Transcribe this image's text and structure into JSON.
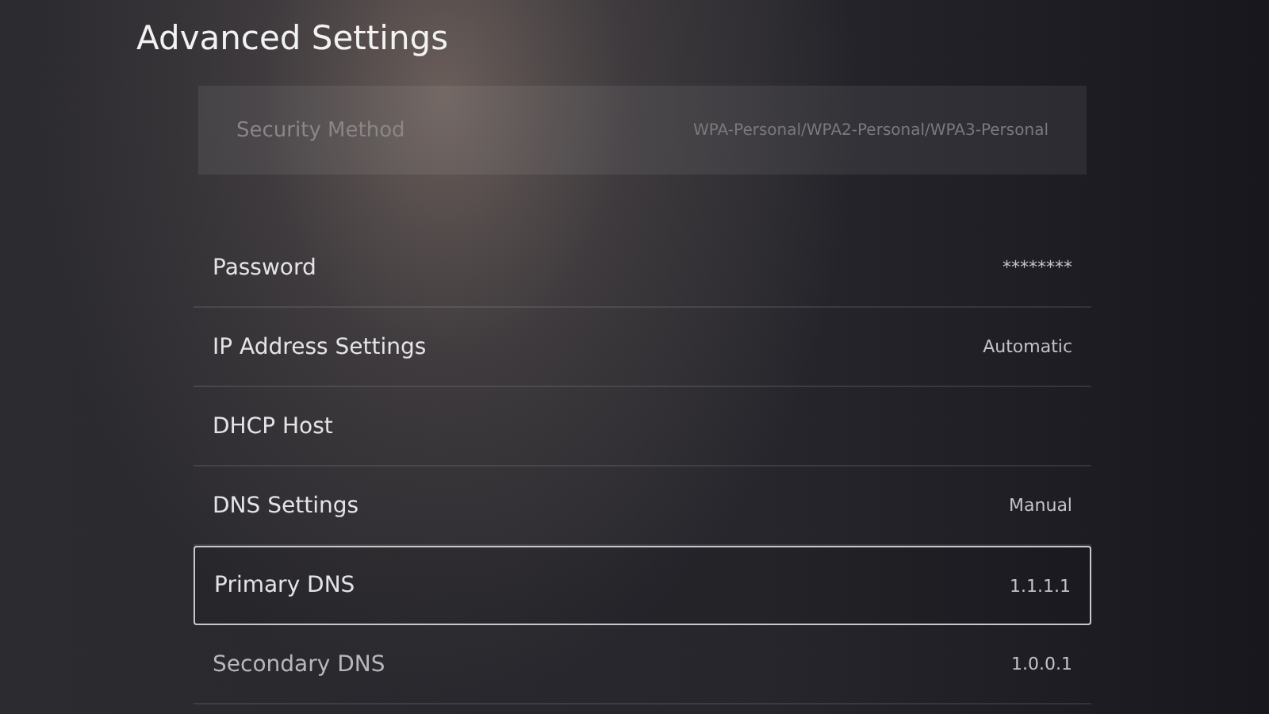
{
  "title": "Advanced Settings",
  "faded_row": {
    "label": "Security Method",
    "value": "WPA-Personal/WPA2-Personal/WPA3-Personal"
  },
  "rows": [
    {
      "label": "Password",
      "value": "********",
      "selected": false
    },
    {
      "label": "IP Address Settings",
      "value": "Automatic",
      "selected": false
    },
    {
      "label": "DHCP Host",
      "selected": false
    },
    {
      "label": "DNS Settings",
      "value": "Manual",
      "selected": false
    },
    {
      "label": "Primary DNS",
      "value": "1.1.1.1",
      "selected": true
    },
    {
      "label": "Secondary DNS",
      "value": "1.0.0.1",
      "selected": false
    }
  ]
}
